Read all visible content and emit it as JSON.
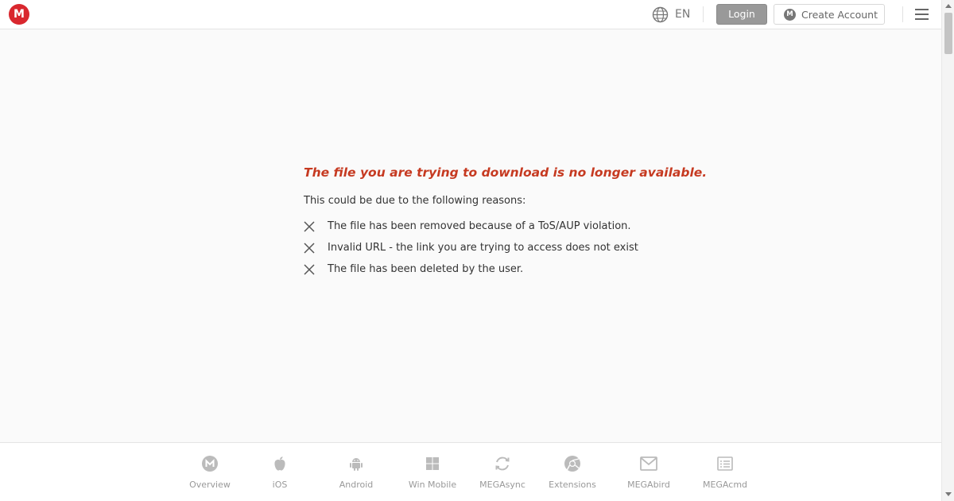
{
  "header": {
    "logo_letter": "M",
    "language": "EN",
    "login_label": "Login",
    "create_account_label": "Create Account",
    "create_account_logo_letter": "M"
  },
  "main": {
    "title": "The file you are trying to download is no longer available.",
    "intro": "This could be due to the following reasons:",
    "reasons": [
      "The file has been removed because of a ToS/AUP violation.",
      "Invalid URL - the link you are trying to access does not exist",
      "The file has been deleted by the user."
    ]
  },
  "footer": {
    "items": [
      {
        "label": "Overview",
        "icon": "mega-logo-icon"
      },
      {
        "label": "iOS",
        "icon": "apple-icon"
      },
      {
        "label": "Android",
        "icon": "android-icon"
      },
      {
        "label": "Win Mobile",
        "icon": "windows-icon"
      },
      {
        "label": "MEGAsync",
        "icon": "sync-icon"
      },
      {
        "label": "Extensions",
        "icon": "extensions-icon"
      },
      {
        "label": "MEGAbird",
        "icon": "mail-icon"
      },
      {
        "label": "MEGAcmd",
        "icon": "terminal-icon"
      }
    ]
  },
  "colors": {
    "brand": "#d9272e",
    "error_title": "#c63a21",
    "footer_text": "#999999"
  }
}
